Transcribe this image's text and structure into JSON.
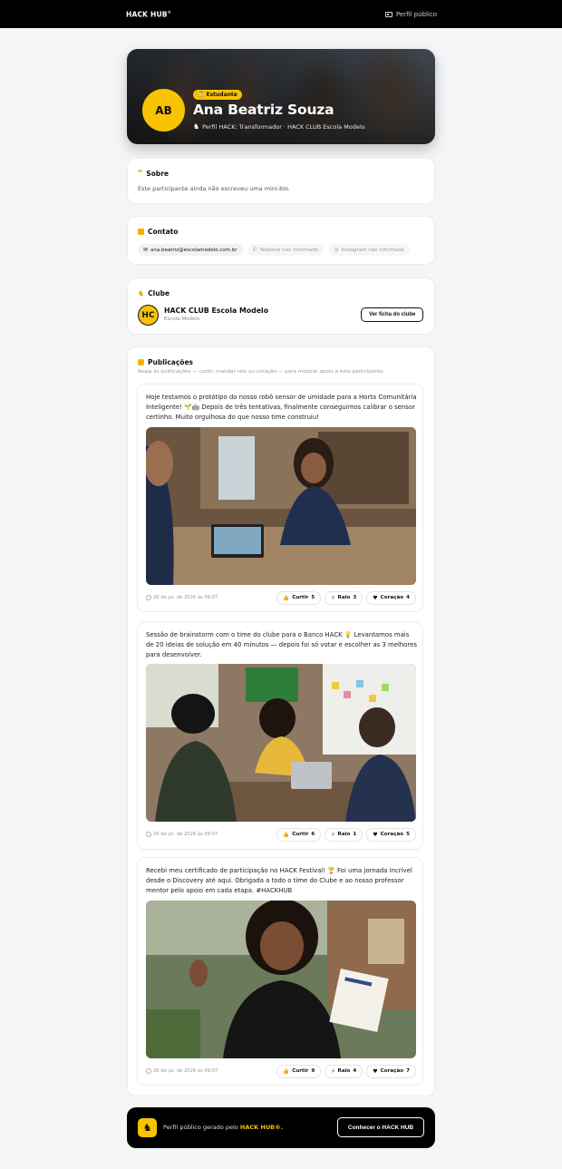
{
  "nav": {
    "brand": "HACK HUB",
    "brand_mark": "®",
    "public_link": "Perfil público"
  },
  "profile": {
    "initials": "AB",
    "role_badge": "Estudante",
    "name": "Ana Beatriz Souza",
    "subtitle": "Perfil HACK: Transformador · HACK CLUB Escola Modelo"
  },
  "about": {
    "title": "Sobre",
    "text": "Este participante ainda não escreveu uma mini-bio."
  },
  "contact": {
    "title": "Contato",
    "email": "ana.beatriz@escolamodelo.com.br",
    "phone": "Telefone não informado",
    "instagram": "Instagram não informado"
  },
  "club": {
    "title": "Clube",
    "logo": "HC",
    "name": "HACK CLUB Escola Modelo",
    "school": "Escola Modelo",
    "button": "Ver ficha do clube"
  },
  "posts_section": {
    "title": "Publicações",
    "subtitle": "Reaja às publicações — curtir, mandar raio ou coração — para mostrar apoio a este participante."
  },
  "posts": [
    {
      "text": "Hoje testamos o protótipo do nosso robô sensor de umidade para a Horta Comunitária Inteligente! 🌱🤖 Depois de três tentativas, finalmente conseguimos calibrar o sensor certinho. Muito orgulhosa do que nosso time construiu!",
      "date": "26 de jul. de 2026 às 09:07",
      "likes_label": "Curtir",
      "likes": "5",
      "bolt_label": "Raio",
      "bolts": "3",
      "heart_label": "Coração",
      "hearts": "4"
    },
    {
      "text": "Sessão de brainstorm com o time do clube para o Banco HACK 💡 Levantamos mais de 20 ideias de solução em 40 minutos — depois foi só votar e escolher as 3 melhores para desenvolver.",
      "date": "26 de jul. de 2026 às 09:07",
      "likes_label": "Curtir",
      "likes": "6",
      "bolt_label": "Raio",
      "bolts": "1",
      "heart_label": "Coração",
      "hearts": "5"
    },
    {
      "text": "Recebi meu certificado de participação no HACK Festival! 🏆 Foi uma jornada incrível desde o Discovery até aqui. Obrigada a todo o time do Clube e ao nosso professor mentor pelo apoio em cada etapa. #HACKHUB",
      "date": "26 de jul. de 2026 às 09:07",
      "likes_label": "Curtir",
      "likes": "9",
      "bolt_label": "Raio",
      "bolts": "4",
      "heart_label": "Coração",
      "hearts": "7"
    }
  ],
  "footer": {
    "text_prefix": "Perfil público gerado pelo",
    "brand": "HACK HUB®.",
    "button": "Conhecer o HACK HUB"
  }
}
